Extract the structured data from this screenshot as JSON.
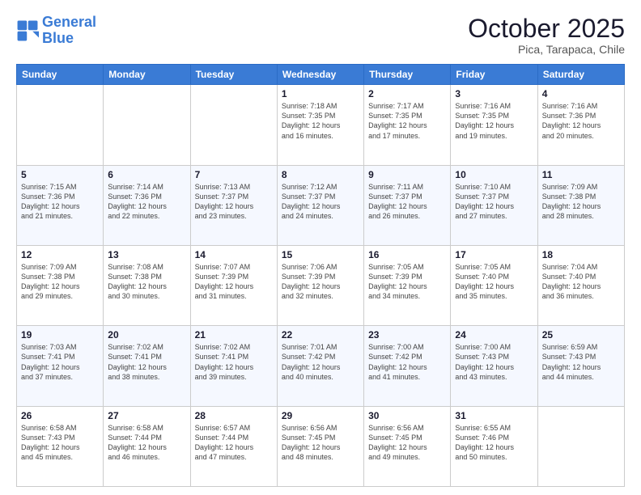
{
  "logo": {
    "line1": "General",
    "line2": "Blue"
  },
  "header": {
    "month": "October 2025",
    "location": "Pica, Tarapaca, Chile"
  },
  "weekdays": [
    "Sunday",
    "Monday",
    "Tuesday",
    "Wednesday",
    "Thursday",
    "Friday",
    "Saturday"
  ],
  "weeks": [
    [
      {
        "day": "",
        "info": ""
      },
      {
        "day": "",
        "info": ""
      },
      {
        "day": "",
        "info": ""
      },
      {
        "day": "1",
        "info": "Sunrise: 7:18 AM\nSunset: 7:35 PM\nDaylight: 12 hours\nand 16 minutes."
      },
      {
        "day": "2",
        "info": "Sunrise: 7:17 AM\nSunset: 7:35 PM\nDaylight: 12 hours\nand 17 minutes."
      },
      {
        "day": "3",
        "info": "Sunrise: 7:16 AM\nSunset: 7:35 PM\nDaylight: 12 hours\nand 19 minutes."
      },
      {
        "day": "4",
        "info": "Sunrise: 7:16 AM\nSunset: 7:36 PM\nDaylight: 12 hours\nand 20 minutes."
      }
    ],
    [
      {
        "day": "5",
        "info": "Sunrise: 7:15 AM\nSunset: 7:36 PM\nDaylight: 12 hours\nand 21 minutes."
      },
      {
        "day": "6",
        "info": "Sunrise: 7:14 AM\nSunset: 7:36 PM\nDaylight: 12 hours\nand 22 minutes."
      },
      {
        "day": "7",
        "info": "Sunrise: 7:13 AM\nSunset: 7:37 PM\nDaylight: 12 hours\nand 23 minutes."
      },
      {
        "day": "8",
        "info": "Sunrise: 7:12 AM\nSunset: 7:37 PM\nDaylight: 12 hours\nand 24 minutes."
      },
      {
        "day": "9",
        "info": "Sunrise: 7:11 AM\nSunset: 7:37 PM\nDaylight: 12 hours\nand 26 minutes."
      },
      {
        "day": "10",
        "info": "Sunrise: 7:10 AM\nSunset: 7:37 PM\nDaylight: 12 hours\nand 27 minutes."
      },
      {
        "day": "11",
        "info": "Sunrise: 7:09 AM\nSunset: 7:38 PM\nDaylight: 12 hours\nand 28 minutes."
      }
    ],
    [
      {
        "day": "12",
        "info": "Sunrise: 7:09 AM\nSunset: 7:38 PM\nDaylight: 12 hours\nand 29 minutes."
      },
      {
        "day": "13",
        "info": "Sunrise: 7:08 AM\nSunset: 7:38 PM\nDaylight: 12 hours\nand 30 minutes."
      },
      {
        "day": "14",
        "info": "Sunrise: 7:07 AM\nSunset: 7:39 PM\nDaylight: 12 hours\nand 31 minutes."
      },
      {
        "day": "15",
        "info": "Sunrise: 7:06 AM\nSunset: 7:39 PM\nDaylight: 12 hours\nand 32 minutes."
      },
      {
        "day": "16",
        "info": "Sunrise: 7:05 AM\nSunset: 7:39 PM\nDaylight: 12 hours\nand 34 minutes."
      },
      {
        "day": "17",
        "info": "Sunrise: 7:05 AM\nSunset: 7:40 PM\nDaylight: 12 hours\nand 35 minutes."
      },
      {
        "day": "18",
        "info": "Sunrise: 7:04 AM\nSunset: 7:40 PM\nDaylight: 12 hours\nand 36 minutes."
      }
    ],
    [
      {
        "day": "19",
        "info": "Sunrise: 7:03 AM\nSunset: 7:41 PM\nDaylight: 12 hours\nand 37 minutes."
      },
      {
        "day": "20",
        "info": "Sunrise: 7:02 AM\nSunset: 7:41 PM\nDaylight: 12 hours\nand 38 minutes."
      },
      {
        "day": "21",
        "info": "Sunrise: 7:02 AM\nSunset: 7:41 PM\nDaylight: 12 hours\nand 39 minutes."
      },
      {
        "day": "22",
        "info": "Sunrise: 7:01 AM\nSunset: 7:42 PM\nDaylight: 12 hours\nand 40 minutes."
      },
      {
        "day": "23",
        "info": "Sunrise: 7:00 AM\nSunset: 7:42 PM\nDaylight: 12 hours\nand 41 minutes."
      },
      {
        "day": "24",
        "info": "Sunrise: 7:00 AM\nSunset: 7:43 PM\nDaylight: 12 hours\nand 43 minutes."
      },
      {
        "day": "25",
        "info": "Sunrise: 6:59 AM\nSunset: 7:43 PM\nDaylight: 12 hours\nand 44 minutes."
      }
    ],
    [
      {
        "day": "26",
        "info": "Sunrise: 6:58 AM\nSunset: 7:43 PM\nDaylight: 12 hours\nand 45 minutes."
      },
      {
        "day": "27",
        "info": "Sunrise: 6:58 AM\nSunset: 7:44 PM\nDaylight: 12 hours\nand 46 minutes."
      },
      {
        "day": "28",
        "info": "Sunrise: 6:57 AM\nSunset: 7:44 PM\nDaylight: 12 hours\nand 47 minutes."
      },
      {
        "day": "29",
        "info": "Sunrise: 6:56 AM\nSunset: 7:45 PM\nDaylight: 12 hours\nand 48 minutes."
      },
      {
        "day": "30",
        "info": "Sunrise: 6:56 AM\nSunset: 7:45 PM\nDaylight: 12 hours\nand 49 minutes."
      },
      {
        "day": "31",
        "info": "Sunrise: 6:55 AM\nSunset: 7:46 PM\nDaylight: 12 hours\nand 50 minutes."
      },
      {
        "day": "",
        "info": ""
      }
    ]
  ]
}
